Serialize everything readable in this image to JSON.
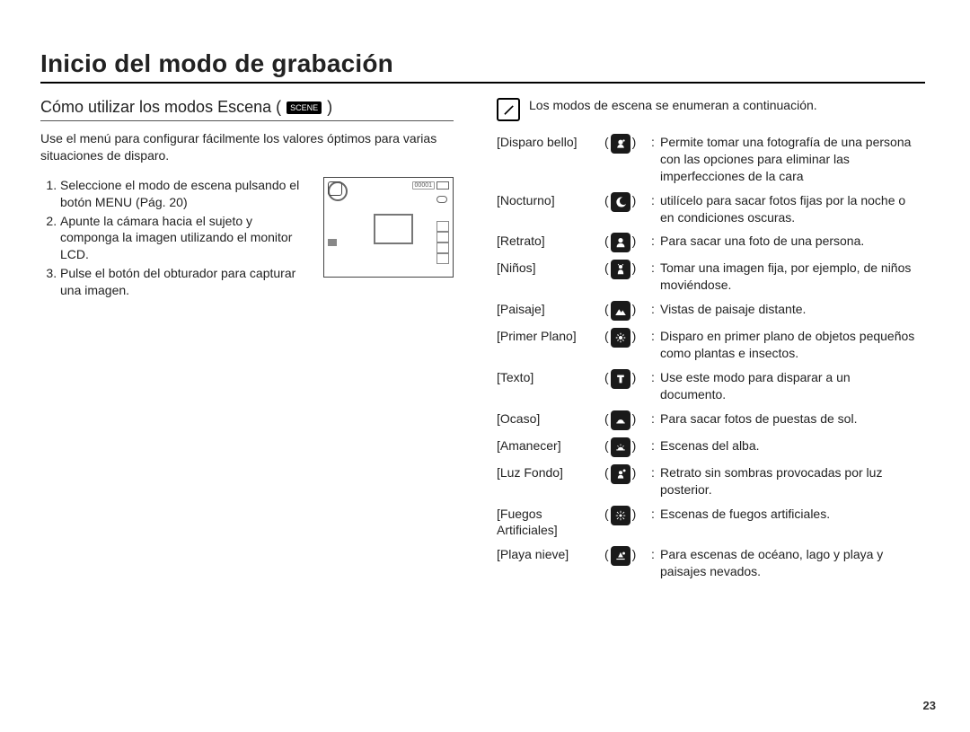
{
  "page": {
    "title": "Inicio del modo de grabación",
    "page_number": "23"
  },
  "left": {
    "subhead": "Cómo utilizar los modos Escena (",
    "subhead_close": ")",
    "scene_pill": "SCENE",
    "intro": "Use el menú para configurar fácilmente los valores óptimos para varias situaciones de disparo.",
    "steps": [
      "Seleccione el modo de escena pulsando el botón MENU (Pág. 20)",
      "Apunte la cámara hacia el sujeto y componga la imagen utilizando el monitor LCD.",
      "Pulse el botón del obturador para capturar una imagen."
    ],
    "monitor_counter": "00001"
  },
  "right": {
    "note": "Los modos de escena se enumeran a continuación.",
    "scenes": [
      {
        "label": "[Disparo bello]",
        "icon": "beauty",
        "desc": "Permite tomar una fotografía de una persona con las opciones para eliminar las imperfecciones de la cara"
      },
      {
        "label": "[Nocturno]",
        "icon": "night",
        "desc": "utilícelo para sacar fotos fijas por la noche o en condiciones oscuras."
      },
      {
        "label": "[Retrato]",
        "icon": "portrait",
        "desc": "Para sacar una foto de una persona."
      },
      {
        "label": "[Niños]",
        "icon": "children",
        "desc": "Tomar una imagen fija, por ejemplo, de niños moviéndose."
      },
      {
        "label": "[Paisaje]",
        "icon": "landscape",
        "desc": "Vistas de paisaje distante."
      },
      {
        "label": "[Primer Plano]",
        "icon": "closeup",
        "desc": "Disparo en primer plano de objetos pequeños como plantas e insectos."
      },
      {
        "label": "[Texto]",
        "icon": "text",
        "desc": "Use este modo para disparar a un documento."
      },
      {
        "label": "[Ocaso]",
        "icon": "sunset",
        "desc": "Para sacar fotos de puestas de sol."
      },
      {
        "label": "[Amanecer]",
        "icon": "dawn",
        "desc": "Escenas del alba."
      },
      {
        "label": "[Luz Fondo]",
        "icon": "backlight",
        "desc": "Retrato sin sombras provocadas por luz posterior."
      },
      {
        "label": "[Fuegos Artificiales]",
        "icon": "fireworks",
        "desc": "Escenas de fuegos artificiales."
      },
      {
        "label": "[Playa nieve]",
        "icon": "beachsnow",
        "desc": "Para escenas de océano, lago y playa y paisajes nevados."
      }
    ]
  }
}
